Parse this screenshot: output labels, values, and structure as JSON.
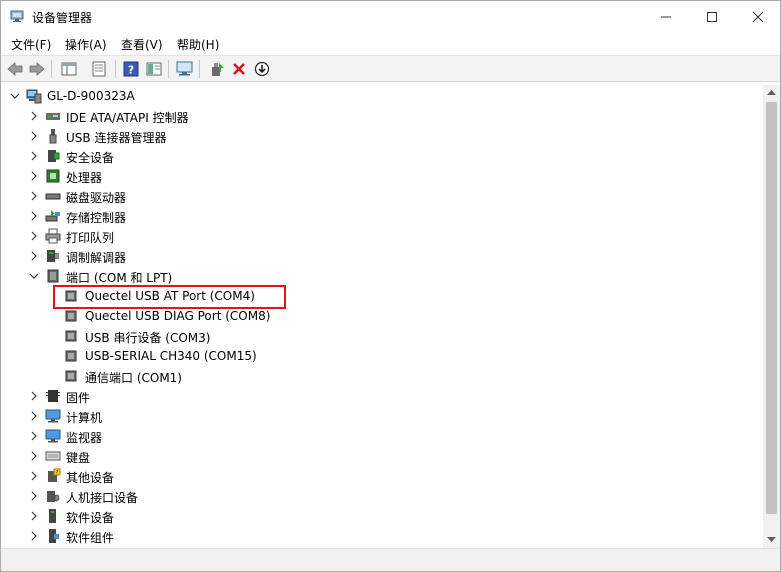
{
  "window": {
    "title": "设备管理器"
  },
  "menu": [
    "文件(F)",
    "操作(A)",
    "查看(V)",
    "帮助(H)"
  ],
  "toolbar": {
    "icons": [
      "back-icon",
      "forward-icon",
      "show-hide-tree-icon",
      "properties-icon",
      "help-icon",
      "view-icon",
      "scan-hardware-icon",
      "update-driver-icon",
      "uninstall-icon",
      "download-driver-icon"
    ]
  },
  "tree": {
    "root": "GL-D-900323A",
    "categories": [
      {
        "label": "IDE ATA/ATAPI 控制器",
        "icon": "ide-controller-icon"
      },
      {
        "label": "USB 连接器管理器",
        "icon": "usb-connector-icon"
      },
      {
        "label": "安全设备",
        "icon": "security-device-icon"
      },
      {
        "label": "处理器",
        "icon": "processor-icon"
      },
      {
        "label": "磁盘驱动器",
        "icon": "disk-drive-icon"
      },
      {
        "label": "存储控制器",
        "icon": "storage-controller-icon"
      },
      {
        "label": "打印队列",
        "icon": "printer-icon"
      },
      {
        "label": "调制解调器",
        "icon": "modem-icon"
      },
      {
        "label": "端口 (COM 和 LPT)",
        "icon": "port-icon"
      }
    ],
    "ports": [
      "Quectel USB AT Port (COM4)",
      "Quectel USB DIAG Port (COM8)",
      "USB 串行设备 (COM3)",
      "USB-SERIAL CH340 (COM15)",
      "通信端口 (COM1)"
    ],
    "more_categories": [
      {
        "label": "固件",
        "icon": "firmware-icon"
      },
      {
        "label": "计算机",
        "icon": "computer-icon"
      },
      {
        "label": "监视器",
        "icon": "monitor-icon"
      },
      {
        "label": "键盘",
        "icon": "keyboard-icon"
      },
      {
        "label": "其他设备",
        "icon": "other-device-icon"
      },
      {
        "label": "人机接口设备",
        "icon": "hid-icon"
      },
      {
        "label": "软件设备",
        "icon": "software-device-icon"
      },
      {
        "label": "软件组件",
        "icon": "software-component-icon"
      }
    ]
  },
  "colors": {
    "highlight_border": "#e8101a",
    "toolbar_bg": "#f3f3f3"
  }
}
